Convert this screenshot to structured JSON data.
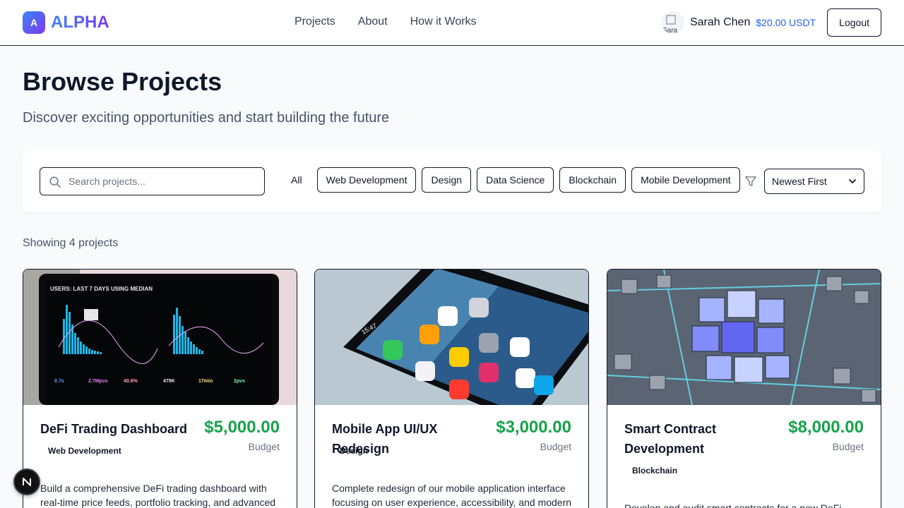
{
  "brand": {
    "mark": "A",
    "name": "ALPHA"
  },
  "nav": [
    {
      "label": "Projects"
    },
    {
      "label": "About"
    },
    {
      "label": "How it Works"
    }
  ],
  "user": {
    "avatar_alt": "Sarah Chen",
    "name": "Sarah Chen",
    "balance": "$20.00 USDT",
    "logout_label": "Logout"
  },
  "page": {
    "title": "Browse Projects",
    "subtitle": "Discover exciting opportunities and start building the future"
  },
  "filters": {
    "search_placeholder": "Search projects...",
    "search_value": "",
    "categories": [
      {
        "label": "All",
        "active": true
      },
      {
        "label": "Web Development",
        "active": false
      },
      {
        "label": "Design",
        "active": false
      },
      {
        "label": "Data Science",
        "active": false
      },
      {
        "label": "Blockchain",
        "active": false
      },
      {
        "label": "Mobile Development",
        "active": false
      }
    ],
    "sort_selected": "Newest First"
  },
  "results": {
    "showing_text": "Showing 4 projects"
  },
  "projects": [
    {
      "title": "DeFi Trading Dashboard",
      "price": "$5,000.00",
      "budget_label": "Budget",
      "category": "Web Development",
      "description": "Build a comprehensive DeFi trading dashboard with real-time price feeds, portfolio tracking, and advanced",
      "image": "analytics-laptop"
    },
    {
      "title": "Mobile App UI/UX Redesign",
      "price": "$3,000.00",
      "budget_label": "Budget",
      "category": "Design",
      "description": "Complete redesign of our mobile application interface focusing on user experience, accessibility, and modern",
      "image": "smartphone-home-screen"
    },
    {
      "title": "Smart Contract Development",
      "price": "$8,000.00",
      "budget_label": "Budget",
      "category": "Blockchain",
      "description": "Develop and audit smart contracts for a new DeFi",
      "image": "blockchain-cubes"
    }
  ],
  "colors": {
    "accent": "#2563eb",
    "price": "#16a34a",
    "brand_from": "#3b82f6",
    "brand_to": "#7c3aed"
  }
}
